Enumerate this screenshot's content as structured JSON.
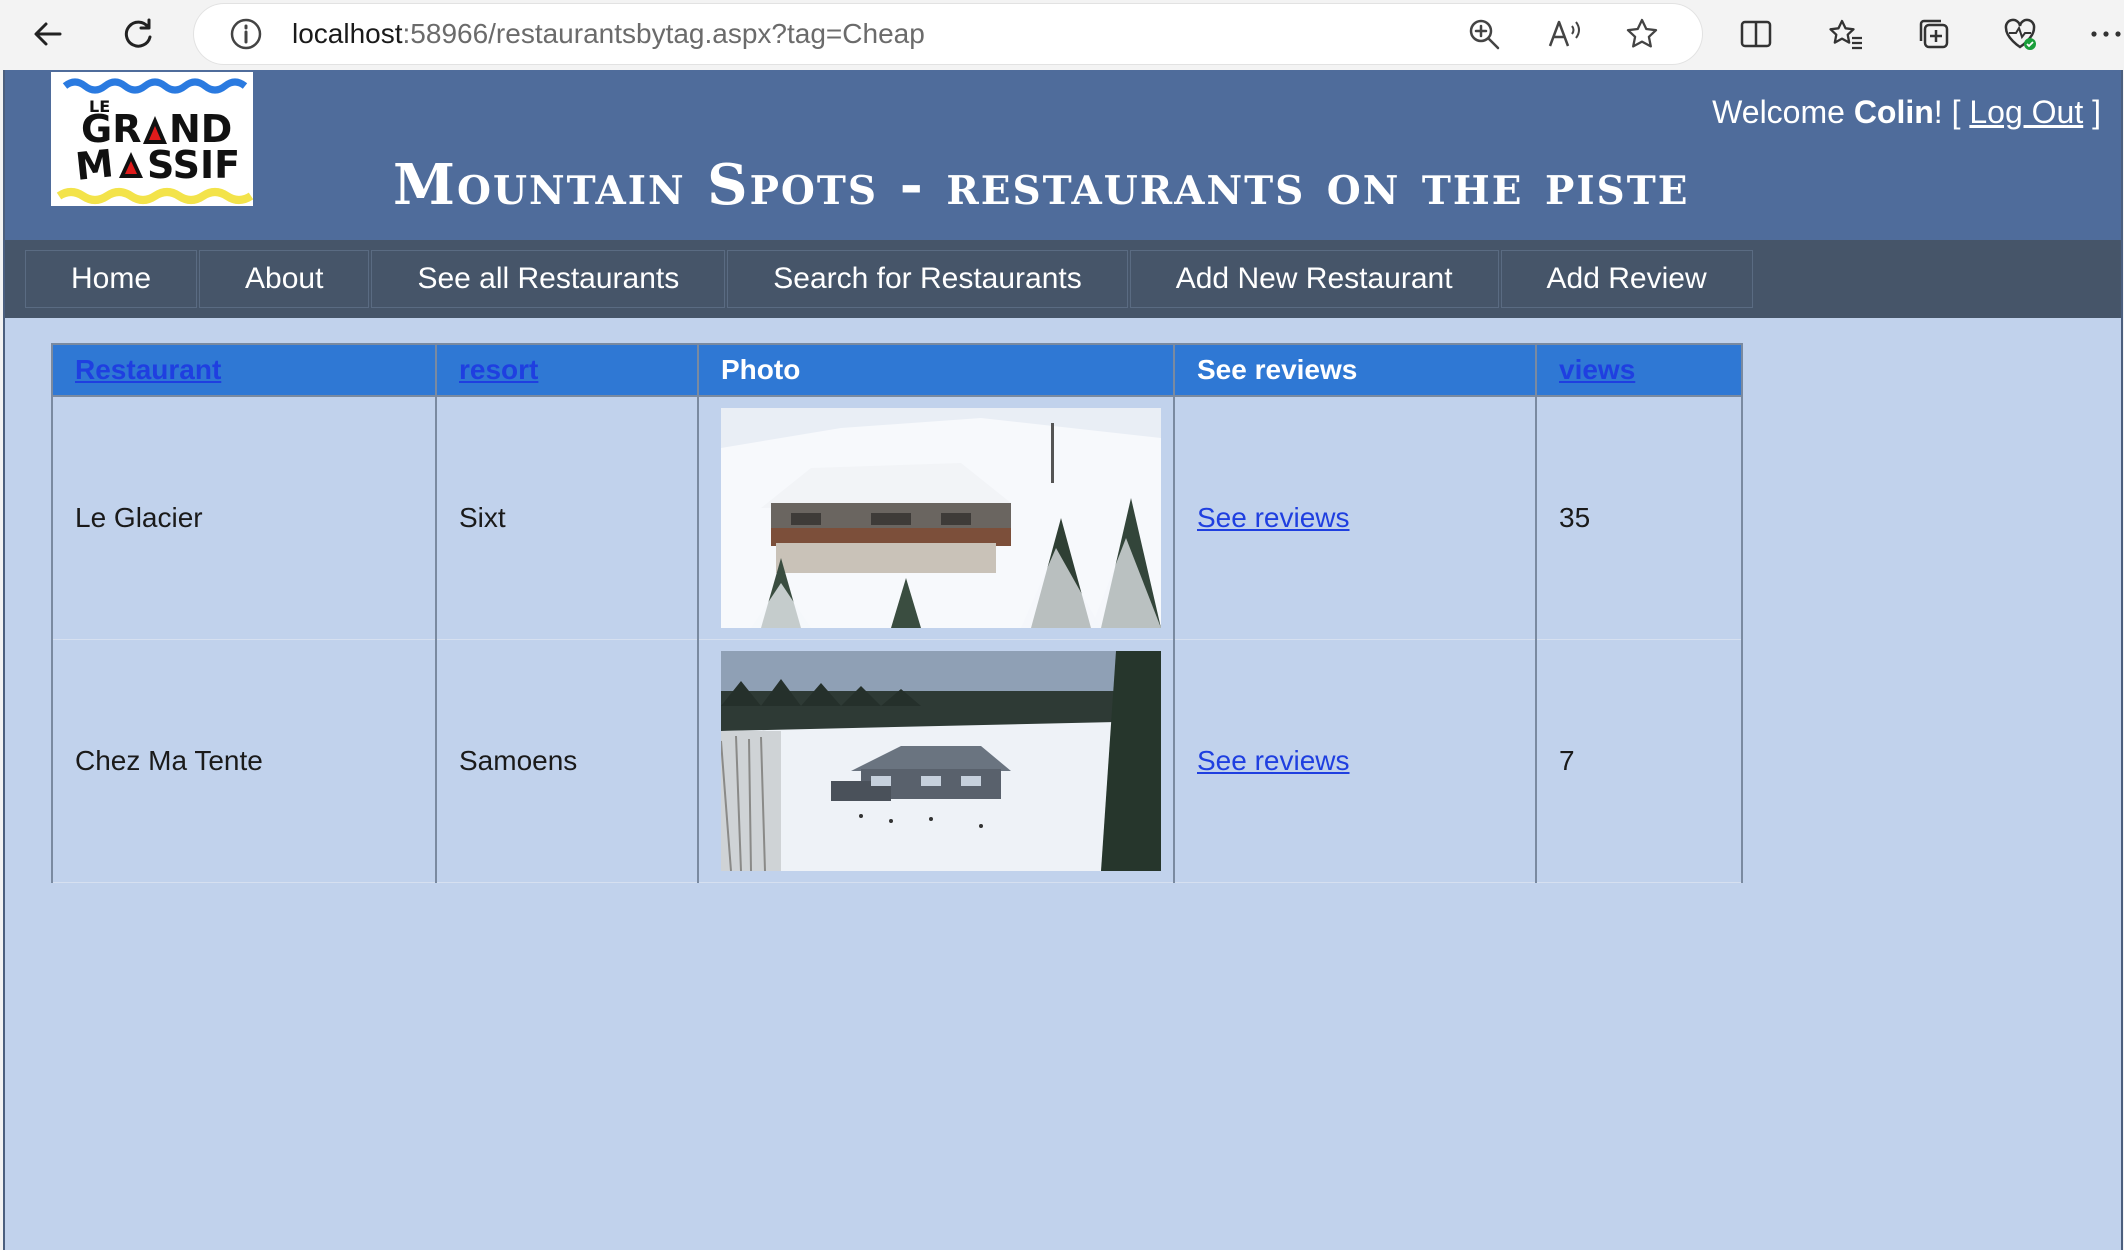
{
  "browser": {
    "url_host": "localhost",
    "url_path": ":58966/restaurantsbytag.aspx?tag=Cheap"
  },
  "header": {
    "logo_alt": "Le Grand Massif",
    "title": "Mountain Spots  - restaurants on the piste",
    "welcome_prefix": "Welcome ",
    "username": "Colin",
    "welcome_suffix": "! [ ",
    "logout_label": "Log Out",
    "bracket_close": " ]"
  },
  "nav": {
    "items": [
      {
        "label": "Home"
      },
      {
        "label": "About"
      },
      {
        "label": "See all Restaurants"
      },
      {
        "label": "Search for Restaurants"
      },
      {
        "label": "Add New Restaurant"
      },
      {
        "label": "Add Review"
      }
    ]
  },
  "table": {
    "headers": {
      "restaurant": "Restaurant",
      "resort": "resort",
      "photo": "Photo",
      "reviews": "See reviews",
      "views": "views"
    },
    "rows": [
      {
        "restaurant": "Le Glacier",
        "resort": "Sixt",
        "reviews_link": "See reviews",
        "views": "35"
      },
      {
        "restaurant": "Chez Ma Tente",
        "resort": "Samoens",
        "reviews_link": "See reviews",
        "views": "7"
      }
    ]
  },
  "colors": {
    "header_bg": "#4f6c9b",
    "nav_bg": "#465569",
    "page_bg": "#c1d2ec",
    "table_header_bg": "#2f78d4",
    "link": "#1f3fe0"
  }
}
